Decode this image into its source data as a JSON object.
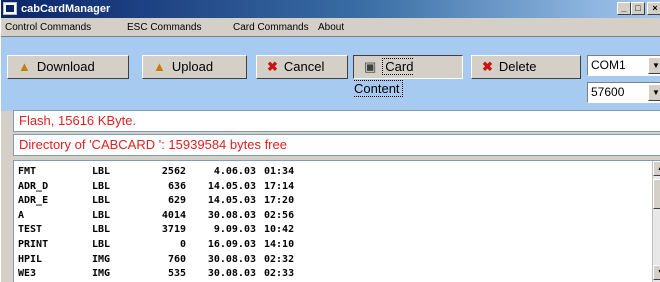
{
  "window": {
    "title": "cabCardManager"
  },
  "window_controls": {
    "minimize": "_",
    "maximize": "□",
    "close": "×"
  },
  "menu": [
    "Control Commands",
    "ESC Commands",
    "Card Commands",
    "About"
  ],
  "toolbar": {
    "download": {
      "label": "Download",
      "icon": "download-icon"
    },
    "upload": {
      "label": "Upload",
      "icon": "upload-icon"
    },
    "cancel": {
      "label": "Cancel",
      "icon": "x-icon"
    },
    "card_content": {
      "label": "Card Content",
      "icon": "card-content-icon"
    },
    "delete": {
      "label": "Delete",
      "icon": "x-icon"
    }
  },
  "port": {
    "value": "COM1",
    "arrow": "▼"
  },
  "baud": {
    "value": "57600",
    "arrow": "▼"
  },
  "status": {
    "flash": "Flash, 15616 KByte.",
    "directory": "Directory of 'CABCARD   ': 15939584 bytes free"
  },
  "files": [
    {
      "name": "FMT",
      "type": "LBL",
      "size": "2562",
      "date": "4.06.03",
      "time": "01:34"
    },
    {
      "name": "ADR_D",
      "type": "LBL",
      "size": "636",
      "date": "14.05.03",
      "time": "17:14"
    },
    {
      "name": "ADR_E",
      "type": "LBL",
      "size": "629",
      "date": "14.05.03",
      "time": "17:20"
    },
    {
      "name": "A",
      "type": "LBL",
      "size": "4014",
      "date": "30.08.03",
      "time": "02:56"
    },
    {
      "name": "TEST",
      "type": "LBL",
      "size": "3719",
      "date": "9.09.03",
      "time": "10:42"
    },
    {
      "name": "PRINT",
      "type": "LBL",
      "size": "0",
      "date": "16.09.03",
      "time": "14:10"
    },
    {
      "name": "HPIL",
      "type": "IMG",
      "size": "760",
      "date": "30.08.03",
      "time": "02:32"
    },
    {
      "name": "WE3",
      "type": "IMG",
      "size": "535",
      "date": "30.08.03",
      "time": "02:33"
    }
  ],
  "scrollbar": {
    "up": "▲",
    "down": "▼"
  },
  "colors": {
    "titlebar": "#0a246a",
    "toolbar_bg": "#a6caf0",
    "status_text": "#e02020"
  }
}
